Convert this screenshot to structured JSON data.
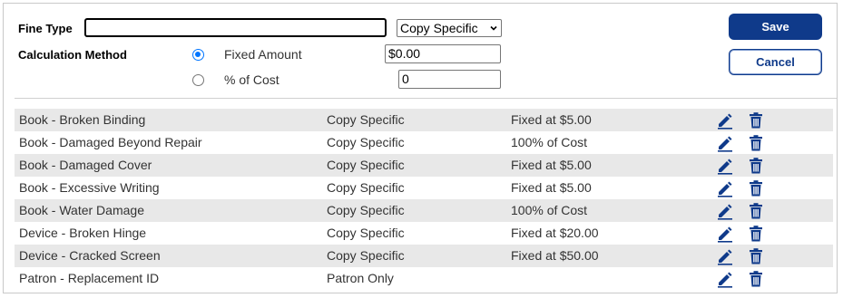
{
  "form": {
    "fine_type_label": "Fine Type",
    "fine_type_value": "",
    "scope_select": "Copy Specific",
    "calc_method_label": "Calculation Method",
    "option_fixed_label": "Fixed Amount",
    "option_fixed_selected": true,
    "fixed_value": "$0.00",
    "option_percent_label": "% of Cost",
    "option_percent_selected": false,
    "percent_value": "0"
  },
  "buttons": {
    "save": "Save",
    "cancel": "Cancel"
  },
  "colors": {
    "accent": "#0f3a8a",
    "row_alt": "#e8e8e8",
    "radio": "#0075ff"
  },
  "rows": [
    {
      "name": "Book - Broken Binding",
      "scope": "Copy Specific",
      "amount": "Fixed at $5.00"
    },
    {
      "name": "Book - Damaged Beyond Repair",
      "scope": "Copy Specific",
      "amount": "100% of Cost"
    },
    {
      "name": "Book - Damaged Cover",
      "scope": "Copy Specific",
      "amount": "Fixed at $5.00"
    },
    {
      "name": "Book - Excessive Writing",
      "scope": "Copy Specific",
      "amount": "Fixed at $5.00"
    },
    {
      "name": "Book - Water Damage",
      "scope": "Copy Specific",
      "amount": "100% of Cost"
    },
    {
      "name": "Device - Broken Hinge",
      "scope": "Copy Specific",
      "amount": "Fixed at $20.00"
    },
    {
      "name": "Device - Cracked Screen",
      "scope": "Copy Specific",
      "amount": "Fixed at $50.00"
    },
    {
      "name": "Patron - Replacement ID",
      "scope": "Patron Only",
      "amount": ""
    }
  ],
  "row_icons": {
    "edit": "pencil-icon",
    "delete": "trash-icon"
  }
}
